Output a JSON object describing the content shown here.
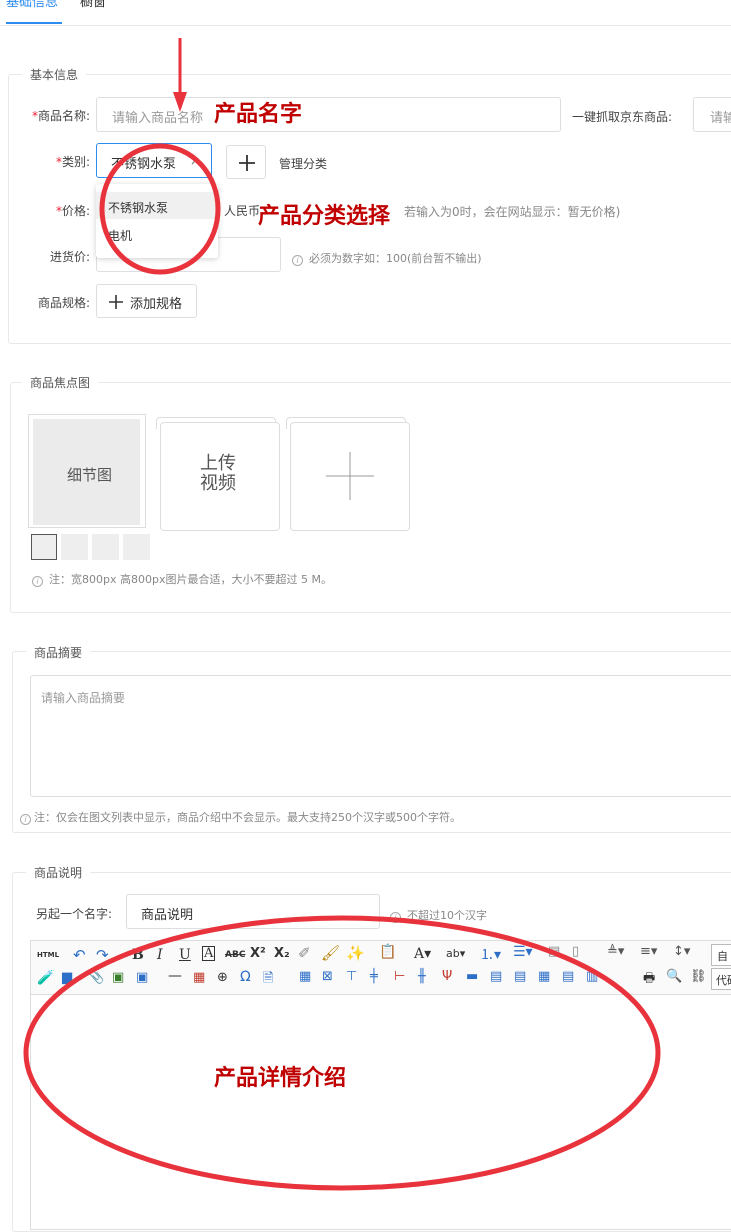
{
  "tabs": [
    "基础信息",
    "橱窗"
  ],
  "basic": {
    "legend": "基本信息",
    "name_label": "商品名称:",
    "name_placeholder": "请输入商品名称",
    "jd_label": "一键抓取京东商品:",
    "jd_placeholder": "请输",
    "category_label": "类别:",
    "category_value": "不锈钢水泵",
    "manage_category": "管理分类",
    "dropdown_options": [
      "不锈钢水泵",
      "电机"
    ],
    "price_label": "价格:",
    "price_unit": "人民币",
    "price_hint": "若输入为0时，会在网站显示：暂无价格)",
    "purchase_label": "进货价:",
    "purchase_hint": "必须为数字如：100(前台暂不输出)",
    "spec_label": "商品规格:",
    "add_spec": "添加规格"
  },
  "focus": {
    "legend": "商品焦点图",
    "detail_label": "细节图",
    "upload_video": "上传\n视频",
    "hint": "注：宽800px 高800px图片最合适，大小不要超过 5 M。"
  },
  "summary": {
    "legend": "商品摘要",
    "placeholder": "请输入商品摘要",
    "hint": "注：仅会在图文列表中显示，商品介绍中不会显示。最大支持250个汉字或500个字符。"
  },
  "desc": {
    "legend": "商品说明",
    "alt_name_label": "另起一个名字:",
    "alt_name_value": "商品说明",
    "alt_name_hint": "不超过10个汉字",
    "font_dropdown": "自",
    "code_dropdown": "代码"
  },
  "annotations": {
    "product_name": "产品名字",
    "category_select": "产品分类选择",
    "product_detail": "产品详情介绍"
  },
  "colors": {
    "accent": "#2d8cf0",
    "annotation": "#e8323c",
    "annotation_text": "#c00000"
  }
}
